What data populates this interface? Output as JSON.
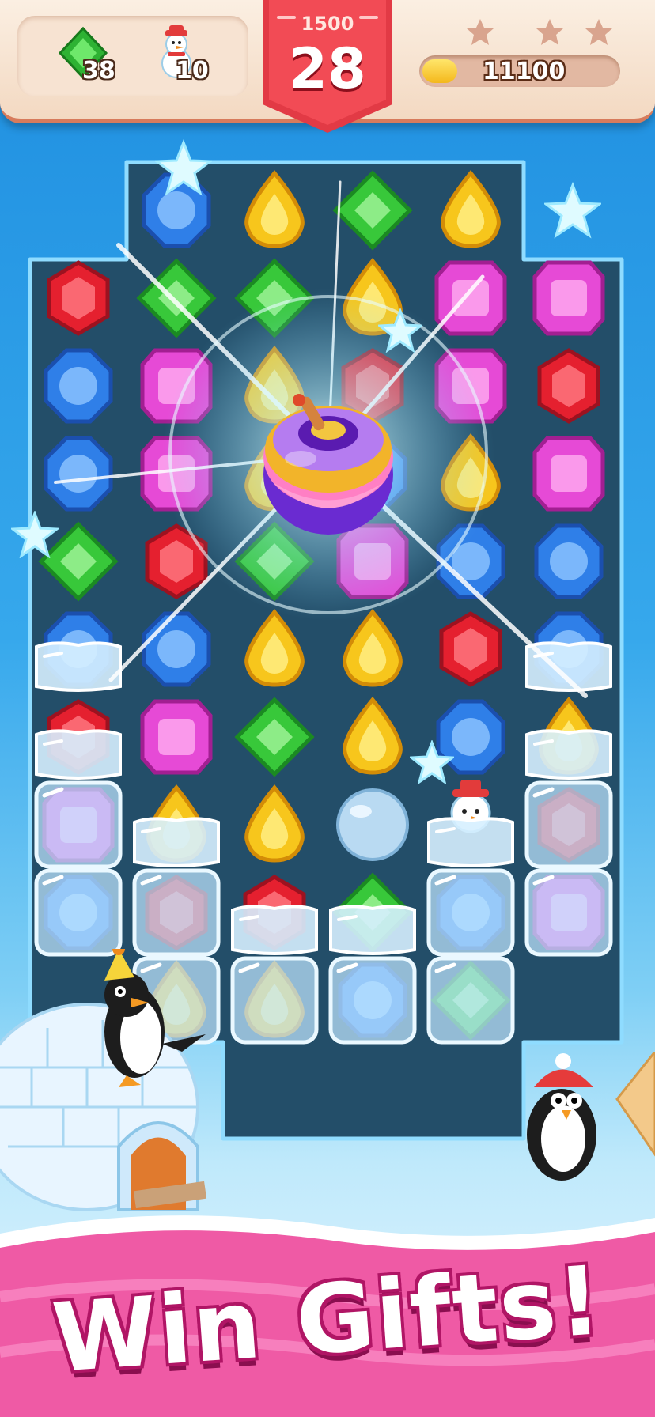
{
  "hud": {
    "goals": [
      {
        "icon": "green-gem-icon",
        "count": "38"
      },
      {
        "icon": "snowman-icon",
        "count": "10"
      }
    ],
    "target_score": "1500",
    "moves_left": "28",
    "stars_earned": 0,
    "stars_total": 3,
    "score": "11100",
    "score_progress": 0.18
  },
  "board": {
    "grid": [
      [
        "none",
        "blue",
        "yellow",
        "green",
        "yellow",
        "none"
      ],
      [
        "red",
        "green",
        "green",
        "yellow",
        "pink",
        "pink"
      ],
      [
        "blue",
        "pink",
        "yellow",
        "red",
        "pink",
        "red"
      ],
      [
        "blue",
        "pink",
        "yellow",
        "blue",
        "yellow",
        "pink"
      ],
      [
        "green",
        "red",
        "green",
        "pink",
        "blue",
        "blue"
      ],
      [
        "blue:ice",
        "blue",
        "yellow",
        "yellow",
        "red",
        "blue:ice"
      ],
      [
        "red:ice",
        "pink",
        "green",
        "yellow",
        "blue",
        "yellow:ice"
      ],
      [
        "pink:block",
        "yellow:ice",
        "yellow",
        "snowball",
        "snowman:ice",
        "red:block"
      ],
      [
        "blue:block",
        "red:block",
        "red:ice",
        "green:ice",
        "blue:block",
        "pink:block"
      ],
      [
        "none",
        "yellow:block",
        "yellow:block",
        "blue:block",
        "green:block",
        "none"
      ]
    ]
  },
  "booster": {
    "icon": "bomb-booster-icon"
  },
  "banner": {
    "text": "Win Gifts!"
  },
  "colors": {
    "red": "#e5202f",
    "blue": "#2f7fe8",
    "yellow": "#f7c61c",
    "green": "#38c83a",
    "pink": "#e64ad6",
    "banner": "#ef5aa5"
  }
}
